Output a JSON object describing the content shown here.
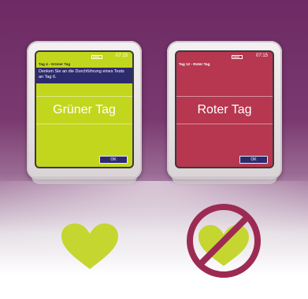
{
  "devices": [
    {
      "id": "green",
      "time": "07:15",
      "header": "Tag 4 - Grüner Tag",
      "message": "Denken Sie an die Durchführung eines Tests an Tag 6.",
      "status_text": "Grüner Tag",
      "ok_label": "OK",
      "screen_color": "#c3d61e"
    },
    {
      "id": "red",
      "time": "07:15",
      "header": "Tag 12 - Roter Tag",
      "status_text": "Roter Tag",
      "ok_label": "OK",
      "screen_color": "#b6374f"
    }
  ],
  "colors": {
    "heart": "#c5d630",
    "prohibition": "#9c2b53",
    "bg_top": "#6d2a63"
  },
  "icons": [
    "heart-icon",
    "crossed-heart-icon"
  ]
}
